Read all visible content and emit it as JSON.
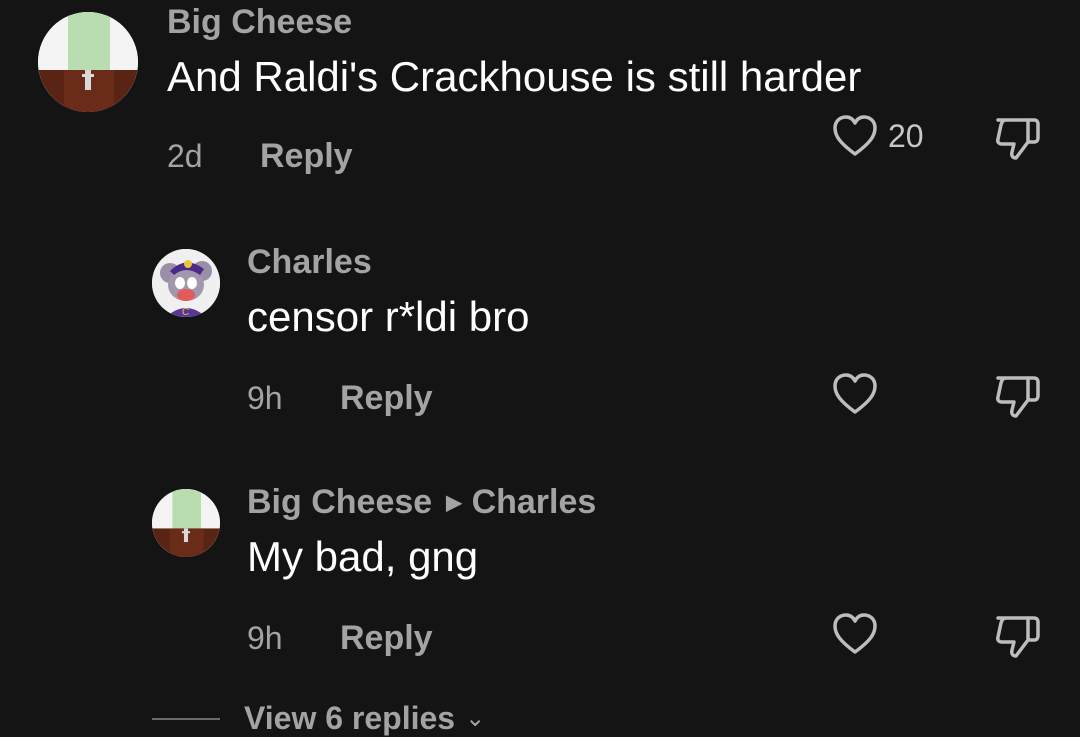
{
  "comments": [
    {
      "author": "Big Cheese",
      "text": "And Raldi's Crackhouse is still harder",
      "time": "2d",
      "reply": "Reply",
      "likes": "20"
    },
    {
      "author": "Charles",
      "text": "censor r*ldi bro",
      "time": "9h",
      "reply": "Reply",
      "likes": ""
    },
    {
      "author": "Big Cheese",
      "reply_to": "Charles",
      "text": "My bad, gng",
      "time": "9h",
      "reply": "Reply",
      "likes": ""
    }
  ],
  "view_replies": "View 6 replies",
  "icons": {
    "like": "heart-icon",
    "dislike": "thumbs-down-icon",
    "avatar_charles": "mouse-mascot-avatar",
    "avatar_bigcheese": "green-block-avatar"
  }
}
